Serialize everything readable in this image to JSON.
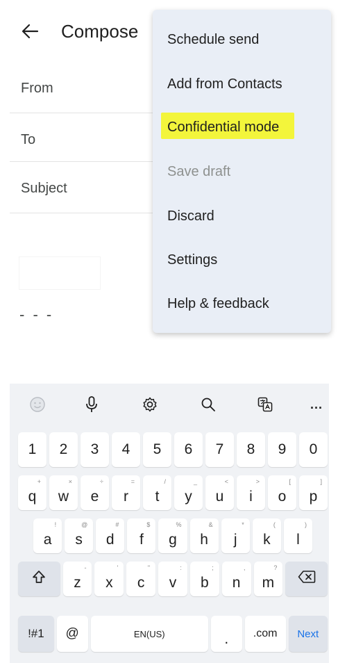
{
  "header": {
    "title": "Compose"
  },
  "fields": {
    "from_label": "From",
    "to_label": "To",
    "subject_label": "Subject"
  },
  "body": {
    "signature_dash": "- - -"
  },
  "menu": {
    "items": [
      {
        "label": "Schedule send",
        "enabled": true
      },
      {
        "label": "Add from Contacts",
        "enabled": true
      },
      {
        "label": "Confidential mode",
        "enabled": true,
        "highlighted": true
      },
      {
        "label": "Save draft",
        "enabled": false
      },
      {
        "label": "Discard",
        "enabled": true
      },
      {
        "label": "Settings",
        "enabled": true
      },
      {
        "label": "Help & feedback",
        "enabled": true
      }
    ],
    "highlight_color": "#f3f53b"
  },
  "keyboard": {
    "toolbar": [
      "emoji-icon",
      "microphone-icon",
      "settings-icon",
      "search-icon",
      "translate-icon",
      "more-icon"
    ],
    "more_label": "...",
    "row_numbers": [
      "1",
      "2",
      "3",
      "4",
      "5",
      "6",
      "7",
      "8",
      "9",
      "0"
    ],
    "row_top": [
      {
        "k": "q",
        "h": "+"
      },
      {
        "k": "w",
        "h": "×"
      },
      {
        "k": "e",
        "h": "÷"
      },
      {
        "k": "r",
        "h": "="
      },
      {
        "k": "t",
        "h": "/"
      },
      {
        "k": "y",
        "h": "_"
      },
      {
        "k": "u",
        "h": "<"
      },
      {
        "k": "i",
        "h": ">"
      },
      {
        "k": "o",
        "h": "["
      },
      {
        "k": "p",
        "h": "]"
      }
    ],
    "row_mid": [
      {
        "k": "a",
        "h": "!"
      },
      {
        "k": "s",
        "h": "@"
      },
      {
        "k": "d",
        "h": "#"
      },
      {
        "k": "f",
        "h": "$"
      },
      {
        "k": "g",
        "h": "%"
      },
      {
        "k": "h",
        "h": "&"
      },
      {
        "k": "j",
        "h": "*"
      },
      {
        "k": "k",
        "h": "("
      },
      {
        "k": "l",
        "h": ")"
      }
    ],
    "row_bottom": [
      {
        "k": "z",
        "h": "-"
      },
      {
        "k": "x",
        "h": "'"
      },
      {
        "k": "c",
        "h": "\""
      },
      {
        "k": "v",
        "h": ":"
      },
      {
        "k": "b",
        "h": ";"
      },
      {
        "k": "n",
        "h": ","
      },
      {
        "k": "m",
        "h": "?"
      }
    ],
    "symbols_label": "!#1",
    "at_label": "@",
    "space_label": "EN(US)",
    "period_label": ".",
    "com_label": ".com",
    "next_label": "Next",
    "accent_color": "#1a73e8"
  }
}
